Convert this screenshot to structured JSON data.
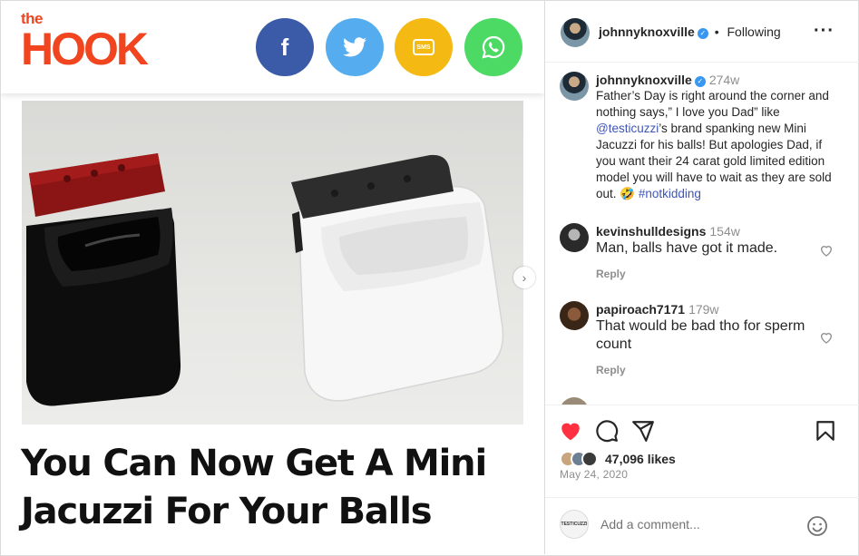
{
  "hook": {
    "logo_the": "the",
    "logo_hook": "HOOK",
    "share": {
      "facebook": "f",
      "twitter": "twitter-bird",
      "sms": "SMS",
      "whatsapp": "whatsapp"
    },
    "headline": "You Can Now Get A Mini Jacuzzi For Your Balls"
  },
  "post": {
    "author": "johnnyknoxville",
    "follow_status": "Following",
    "caption": {
      "username": "johnnyknoxville",
      "age": "274w",
      "text_before": "Father’s Day is right around the corner and nothing says,” I love you Dad” like ",
      "mention": "@testicuzzi",
      "text_middle": "’s brand spanking new Mini Jacuzzi for his balls! But apologies Dad, if you want their 24 carat gold limited edition model you will have to wait as they are sold out. 🤣 ",
      "hashtag": "#notkidding"
    },
    "comments": [
      {
        "username": "kevinshulldesigns",
        "age": "154w",
        "text": "Man, balls have got it made.",
        "reply_label": "Reply"
      },
      {
        "username": "papiroach7171",
        "age": "179w",
        "text": "That would be bad tho for sperm count",
        "reply_label": "Reply"
      }
    ],
    "likes": "47,096 likes",
    "date": "May 24, 2020",
    "add_comment_placeholder": "Add a comment..."
  },
  "colors": {
    "brand_orange": "#f0451f",
    "facebook": "#3b5ba8",
    "twitter": "#55acee",
    "sms": "#f5b914",
    "whatsapp": "#4cd964",
    "like_red": "#ff3040",
    "link_blue": "#3f55b8",
    "verified_blue": "#3897f0"
  }
}
